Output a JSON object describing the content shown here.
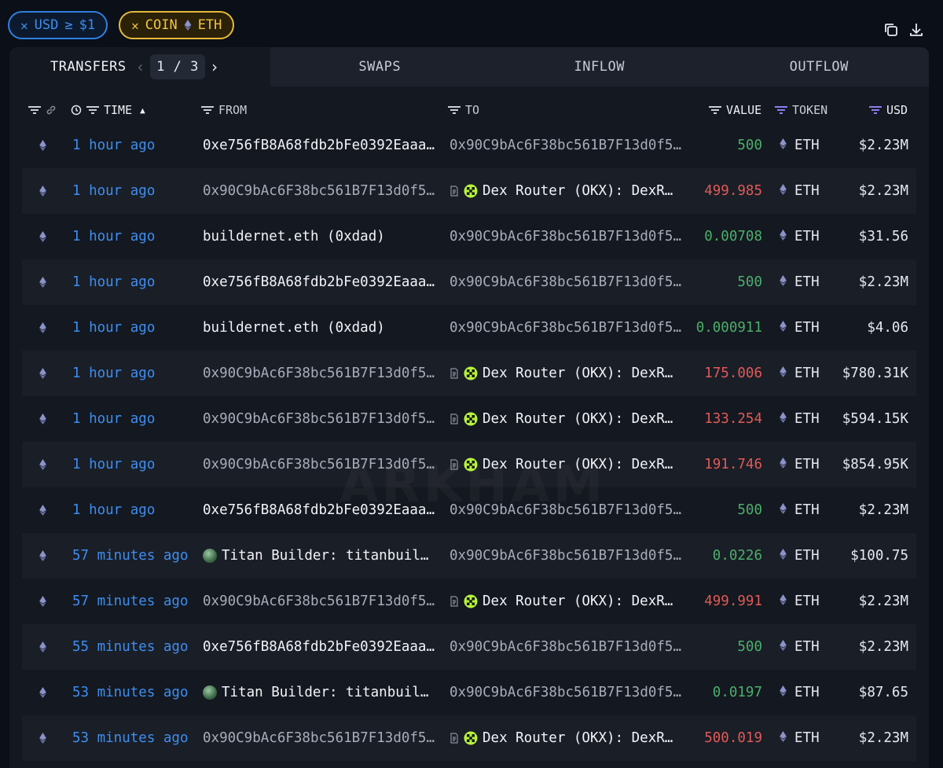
{
  "filters": {
    "usd": {
      "label": "USD",
      "op": "≥",
      "value": "$1"
    },
    "coin": {
      "label": "COIN",
      "value": "ETH"
    }
  },
  "tabs": [
    {
      "label": "TRANSFERS",
      "active": true
    },
    {
      "label": "SWAPS"
    },
    {
      "label": "INFLOW"
    },
    {
      "label": "OUTFLOW"
    }
  ],
  "pager": {
    "current": "1",
    "sep": "/",
    "total": "3"
  },
  "columns": {
    "time": "TIME",
    "from": "FROM",
    "to": "TO",
    "value": "VALUE",
    "token": "TOKEN",
    "usd": "USD"
  },
  "watermark": "ARKHAM",
  "rows": [
    {
      "time": "1 hour ago",
      "from": "0xe756fB8A68fdb2bFe0392Eaaa…",
      "to": "0x90C9bAc6F38bc561B7F13d0f5…",
      "value": "500",
      "token": "ETH",
      "usd": "$2.23M"
    },
    {
      "time": "1 hour ago",
      "from": "0x90C9bAc6F38bc561B7F13d0f5…",
      "to": "Dex Router (OKX): DexR…",
      "value": "499.985",
      "token": "ETH",
      "usd": "$2.23M"
    },
    {
      "time": "1 hour ago",
      "from": "buildernet.eth (0xdad)",
      "to": "0x90C9bAc6F38bc561B7F13d0f5…",
      "value": "0.00708",
      "token": "ETH",
      "usd": "$31.56"
    },
    {
      "time": "1 hour ago",
      "from": "0xe756fB8A68fdb2bFe0392Eaaa…",
      "to": "0x90C9bAc6F38bc561B7F13d0f5…",
      "value": "500",
      "token": "ETH",
      "usd": "$2.23M"
    },
    {
      "time": "1 hour ago",
      "from": "buildernet.eth (0xdad)",
      "to": "0x90C9bAc6F38bc561B7F13d0f5…",
      "value": "0.000911",
      "token": "ETH",
      "usd": "$4.06"
    },
    {
      "time": "1 hour ago",
      "from": "0x90C9bAc6F38bc561B7F13d0f5…",
      "to": "Dex Router (OKX): DexR…",
      "value": "175.006",
      "token": "ETH",
      "usd": "$780.31K"
    },
    {
      "time": "1 hour ago",
      "from": "0x90C9bAc6F38bc561B7F13d0f5…",
      "to": "Dex Router (OKX): DexR…",
      "value": "133.254",
      "token": "ETH",
      "usd": "$594.15K"
    },
    {
      "time": "1 hour ago",
      "from": "0x90C9bAc6F38bc561B7F13d0f5…",
      "to": "Dex Router (OKX): DexR…",
      "value": "191.746",
      "token": "ETH",
      "usd": "$854.95K"
    },
    {
      "time": "1 hour ago",
      "from": "0xe756fB8A68fdb2bFe0392Eaaa…",
      "to": "0x90C9bAc6F38bc561B7F13d0f5…",
      "value": "500",
      "token": "ETH",
      "usd": "$2.23M"
    },
    {
      "time": "57 minutes ago",
      "from": "Titan Builder: titanbuil…",
      "to": "0x90C9bAc6F38bc561B7F13d0f5…",
      "value": "0.0226",
      "token": "ETH",
      "usd": "$100.75"
    },
    {
      "time": "57 minutes ago",
      "from": "0x90C9bAc6F38bc561B7F13d0f5…",
      "to": "Dex Router (OKX): DexR…",
      "value": "499.991",
      "token": "ETH",
      "usd": "$2.23M"
    },
    {
      "time": "55 minutes ago",
      "from": "0xe756fB8A68fdb2bFe0392Eaaa…",
      "to": "0x90C9bAc6F38bc561B7F13d0f5…",
      "value": "500",
      "token": "ETH",
      "usd": "$2.23M"
    },
    {
      "time": "53 minutes ago",
      "from": "Titan Builder: titanbuil…",
      "to": "0x90C9bAc6F38bc561B7F13d0f5…",
      "value": "0.0197",
      "token": "ETH",
      "usd": "$87.65"
    },
    {
      "time": "53 minutes ago",
      "from": "0x90C9bAc6F38bc561B7F13d0f5…",
      "to": "Dex Router (OKX): DexR…",
      "value": "500.019",
      "token": "ETH",
      "usd": "$2.23M"
    }
  ]
}
